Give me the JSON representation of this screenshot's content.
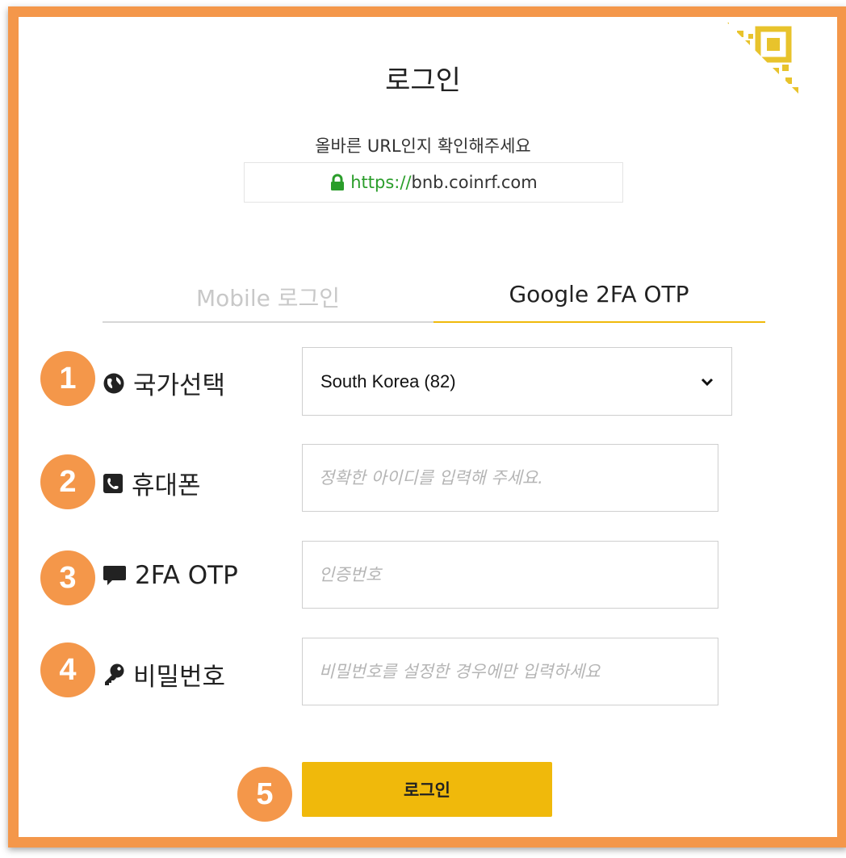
{
  "title": "로그인",
  "url_notice": "올바른 URL인지 확인해주세요",
  "url": {
    "protocol": "https://",
    "host": "bnb.coinrf.com"
  },
  "tabs": [
    {
      "label": "Mobile 로그인",
      "active": false
    },
    {
      "label": "Google 2FA OTP",
      "active": true
    }
  ],
  "rows": [
    {
      "badge": "1",
      "icon": "globe-icon",
      "label": "국가선택"
    },
    {
      "badge": "2",
      "icon": "phone-icon",
      "label": "휴대폰"
    },
    {
      "badge": "3",
      "icon": "chat-icon",
      "label": "2FA OTP"
    },
    {
      "badge": "4",
      "icon": "key-icon",
      "label": "비밀번호"
    }
  ],
  "country_select": {
    "value": "South Korea (82)"
  },
  "phone_field": {
    "placeholder": "정확한 아이디를 입력해 주세요."
  },
  "otp_field": {
    "placeholder": "인증번호"
  },
  "password_field": {
    "placeholder": "비밀번호를 설정한 경우에만 입력하세요"
  },
  "login_button": {
    "badge": "5",
    "label": "로그인"
  },
  "colors": {
    "frame": "#f4974a",
    "accent": "#f0b90b",
    "badge": "#f4974a",
    "url_green": "#2a9d2a"
  }
}
